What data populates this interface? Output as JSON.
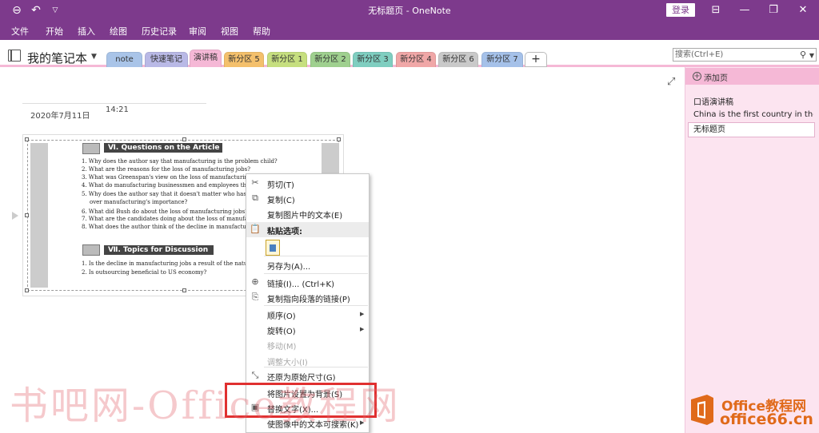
{
  "window": {
    "title": "无标题页 - OneNote",
    "login_label": "登录"
  },
  "menu": [
    "文件",
    "开始",
    "插入",
    "绘图",
    "历史记录",
    "审阅",
    "视图",
    "帮助"
  ],
  "notebook": {
    "name": "我的笔记本"
  },
  "tabs": [
    {
      "label": "note",
      "color": "#a9c4e8"
    },
    {
      "label": "快速笔记",
      "color": "#b9b9e6"
    },
    {
      "label": "演讲稿",
      "color": "#f5b8d6",
      "active": true
    },
    {
      "label": "新分区 5",
      "color": "#f4c06c"
    },
    {
      "label": "新分区 1",
      "color": "#c6df7f"
    },
    {
      "label": "新分区 2",
      "color": "#9fd08f"
    },
    {
      "label": "新分区 3",
      "color": "#7fcec0"
    },
    {
      "label": "新分区 4",
      "color": "#f0a7a7"
    },
    {
      "label": "新分区 6",
      "color": "#c9c9c9"
    },
    {
      "label": "新分区 7",
      "color": "#a5c1e9"
    }
  ],
  "add_tab_label": "+",
  "search": {
    "placeholder": "搜索(Ctrl+E)"
  },
  "page": {
    "date": "2020年7月11日",
    "time": "14:21"
  },
  "article": {
    "section1_title": "Ⅵ. Questions on the Article",
    "questions": [
      "1. Why does the author say that manufacturing is the problem child?",
      "2. What are the reasons for the loss of manufacturing jobs?",
      "3. What was Greenspan's view on the loss of manufacturing jobs?",
      "4. What do manufacturing businessmen and employees think of m",
      "5. Why does the author say that it doesn't matter who has the be",
      "over manufacturing's importance?",
      "6. What did Bush do about the loss of manufacturing jobs?",
      "7. What are the candidates doing about the loss of manufacturing",
      "8. What does the author think of the decline in manufacturing jo"
    ],
    "section2_title": "Ⅶ. Topics for Discussion",
    "topics": [
      "1. Is the decline in manufacturing jobs a result of the natural evo",
      "2. Is outsourcing beneficial to US economy?"
    ]
  },
  "pages_panel": {
    "add_page_label": "添加页",
    "pages": [
      {
        "title": "口语演讲稿",
        "preview": "China is the first country in the"
      },
      {
        "title": "无标题页",
        "selected": true
      }
    ]
  },
  "context_menu": [
    {
      "label": "剪切(T)",
      "icon": "scissors-icon"
    },
    {
      "label": "复制(C)",
      "icon": "copy-icon"
    },
    {
      "label": "复制图片中的文本(E)"
    },
    {
      "label": "粘贴选项:",
      "icon": "paste-icon",
      "header": true
    },
    {
      "label": "另存为(A)..."
    },
    {
      "label": "链接(I)...  (Ctrl+K)",
      "icon": "link-icon"
    },
    {
      "label": "复制指向段落的链接(P)",
      "icon": "paragraph-link-icon"
    },
    {
      "label": "顺序(O)",
      "submenu": true
    },
    {
      "label": "旋转(O)",
      "submenu": true
    },
    {
      "label": "移动(M)",
      "disabled": true
    },
    {
      "label": "调整大小(I)",
      "disabled": true
    },
    {
      "label": "还原为原始尺寸(G)",
      "icon": "restore-size-icon"
    },
    {
      "label": "将图片设置为背景(S)"
    },
    {
      "label": "替换文字(X)...",
      "icon": "alt-text-icon"
    },
    {
      "label": "使图像中的文本可搜索(K)",
      "submenu": true
    }
  ],
  "watermark": {
    "text": "书吧网-Office教程网"
  },
  "brand": {
    "line1": "Office教程网",
    "line2": "office66.cn",
    "color": "#e06a1a"
  }
}
